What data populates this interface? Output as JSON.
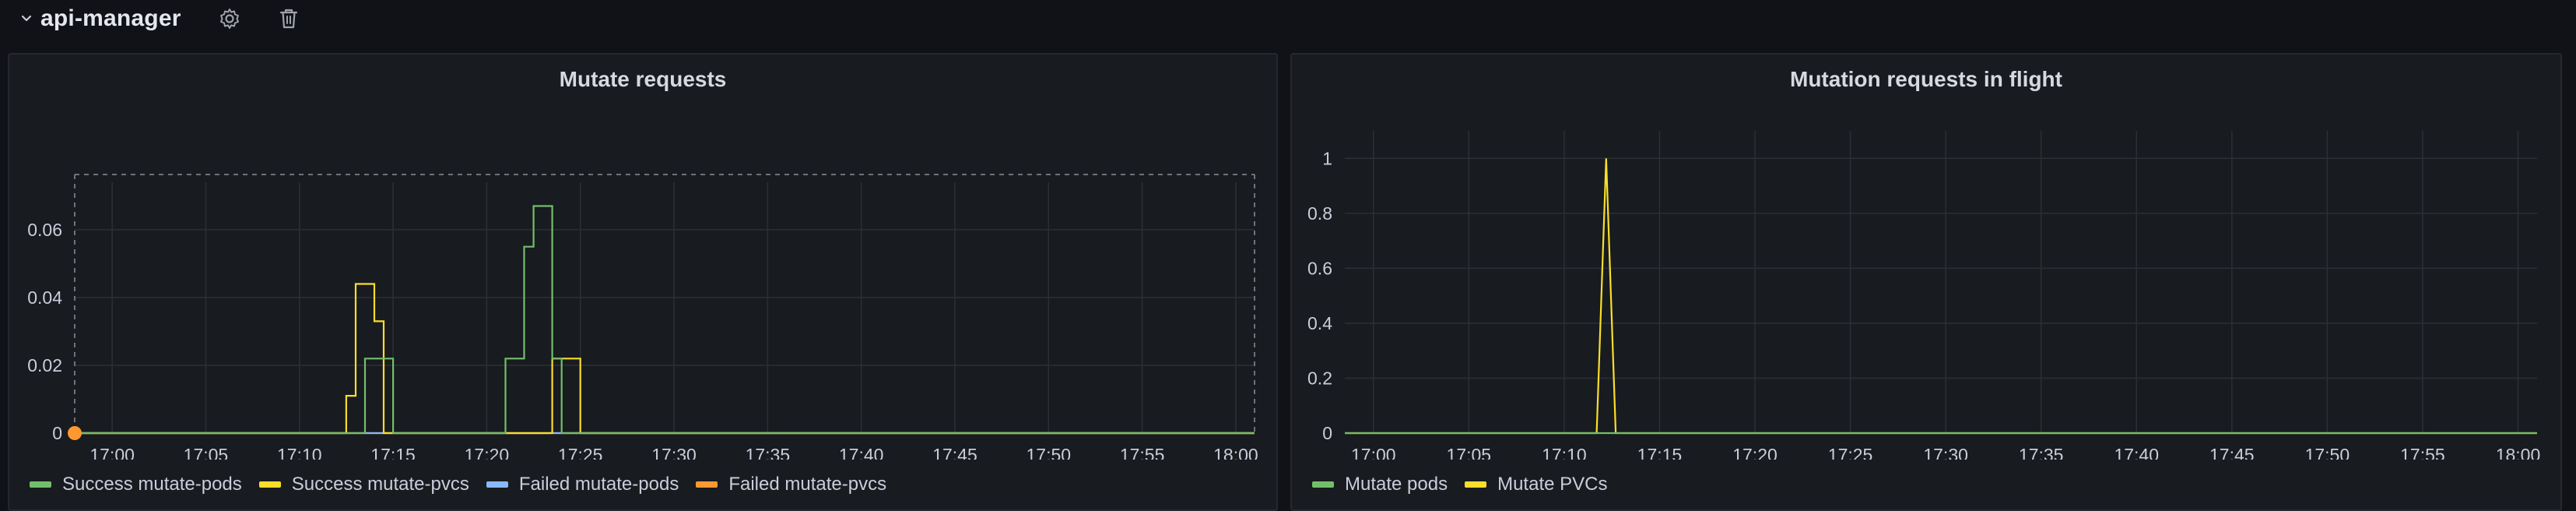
{
  "row": {
    "title": "api-manager",
    "chevron_icon": "chevron-down-icon",
    "settings_icon": "gear-icon",
    "delete_icon": "trash-icon"
  },
  "colors": {
    "green": "#73bf69",
    "yellow": "#fade2a",
    "blue": "#8ab8ff",
    "orange": "#ff9830",
    "grid": "#2c2f35",
    "axis_text": "#ccccdc"
  },
  "chart_data": [
    {
      "type": "line",
      "title": "Mutate requests",
      "xlabel": "",
      "ylabel": "",
      "xlim": [
        "16:58",
        "18:01"
      ],
      "ylim": [
        0,
        0.074
      ],
      "x_ticks": [
        "17:00",
        "17:05",
        "17:10",
        "17:15",
        "17:20",
        "17:25",
        "17:30",
        "17:35",
        "17:40",
        "17:45",
        "17:50",
        "17:55",
        "18:00"
      ],
      "y_ticks": [
        "0",
        "0.02",
        "0.04",
        "0.06"
      ],
      "grid": true,
      "legend_position": "bottom-left",
      "series": [
        {
          "name": "Success mutate-pods",
          "color": "#73bf69",
          "step": true,
          "points": [
            [
              "16:58",
              0
            ],
            [
              "17:13.5",
              0
            ],
            [
              "17:13.5",
              0.022
            ],
            [
              "17:15",
              0.022
            ],
            [
              "17:15",
              0
            ],
            [
              "17:21",
              0
            ],
            [
              "17:21",
              0.022
            ],
            [
              "17:22",
              0.022
            ],
            [
              "17:22",
              0.055
            ],
            [
              "17:22.5",
              0.055
            ],
            [
              "17:22.5",
              0.067
            ],
            [
              "17:23.5",
              0.067
            ],
            [
              "17:23.5",
              0.022
            ],
            [
              "17:24",
              0.022
            ],
            [
              "17:24",
              0
            ],
            [
              "18:01",
              0
            ]
          ]
        },
        {
          "name": "Success mutate-pvcs",
          "color": "#fade2a",
          "step": true,
          "points": [
            [
              "16:58",
              0
            ],
            [
              "17:12.5",
              0
            ],
            [
              "17:12.5",
              0.011
            ],
            [
              "17:13",
              0.011
            ],
            [
              "17:13",
              0.044
            ],
            [
              "17:14",
              0.044
            ],
            [
              "17:14",
              0.033
            ],
            [
              "17:14.5",
              0.033
            ],
            [
              "17:14.5",
              0
            ],
            [
              "17:23.5",
              0
            ],
            [
              "17:23.5",
              0.022
            ],
            [
              "17:25",
              0.022
            ],
            [
              "17:25",
              0
            ],
            [
              "18:01",
              0
            ]
          ]
        },
        {
          "name": "Failed mutate-pods",
          "color": "#8ab8ff",
          "step": true,
          "points": [
            [
              "16:58",
              0
            ],
            [
              "18:01",
              0
            ]
          ]
        },
        {
          "name": "Failed mutate-pvcs",
          "color": "#ff9830",
          "step": true,
          "points": [
            [
              "16:58",
              0
            ],
            [
              "18:01",
              0
            ]
          ]
        }
      ],
      "annotation_marker": {
        "x": "16:58",
        "color": "#ff9830"
      }
    },
    {
      "type": "line",
      "title": "Mutation requests in flight",
      "xlabel": "",
      "ylabel": "",
      "xlim": [
        "16:58.5",
        "18:01"
      ],
      "ylim": [
        0,
        1.1
      ],
      "x_ticks": [
        "17:00",
        "17:05",
        "17:10",
        "17:15",
        "17:20",
        "17:25",
        "17:30",
        "17:35",
        "17:40",
        "17:45",
        "17:50",
        "17:55",
        "18:00"
      ],
      "y_ticks": [
        "0",
        "0.2",
        "0.4",
        "0.6",
        "0.8",
        "1"
      ],
      "grid": true,
      "legend_position": "bottom-left",
      "series": [
        {
          "name": "Mutate pods",
          "color": "#73bf69",
          "step": false,
          "points": [
            [
              "16:58.5",
              0
            ],
            [
              "18:01",
              0
            ]
          ]
        },
        {
          "name": "Mutate PVCs",
          "color": "#fade2a",
          "step": false,
          "points": [
            [
              "16:58.5",
              0
            ],
            [
              "17:11.7",
              0
            ],
            [
              "17:12.2",
              1
            ],
            [
              "17:12.7",
              0
            ],
            [
              "18:01",
              0
            ]
          ]
        }
      ]
    }
  ]
}
